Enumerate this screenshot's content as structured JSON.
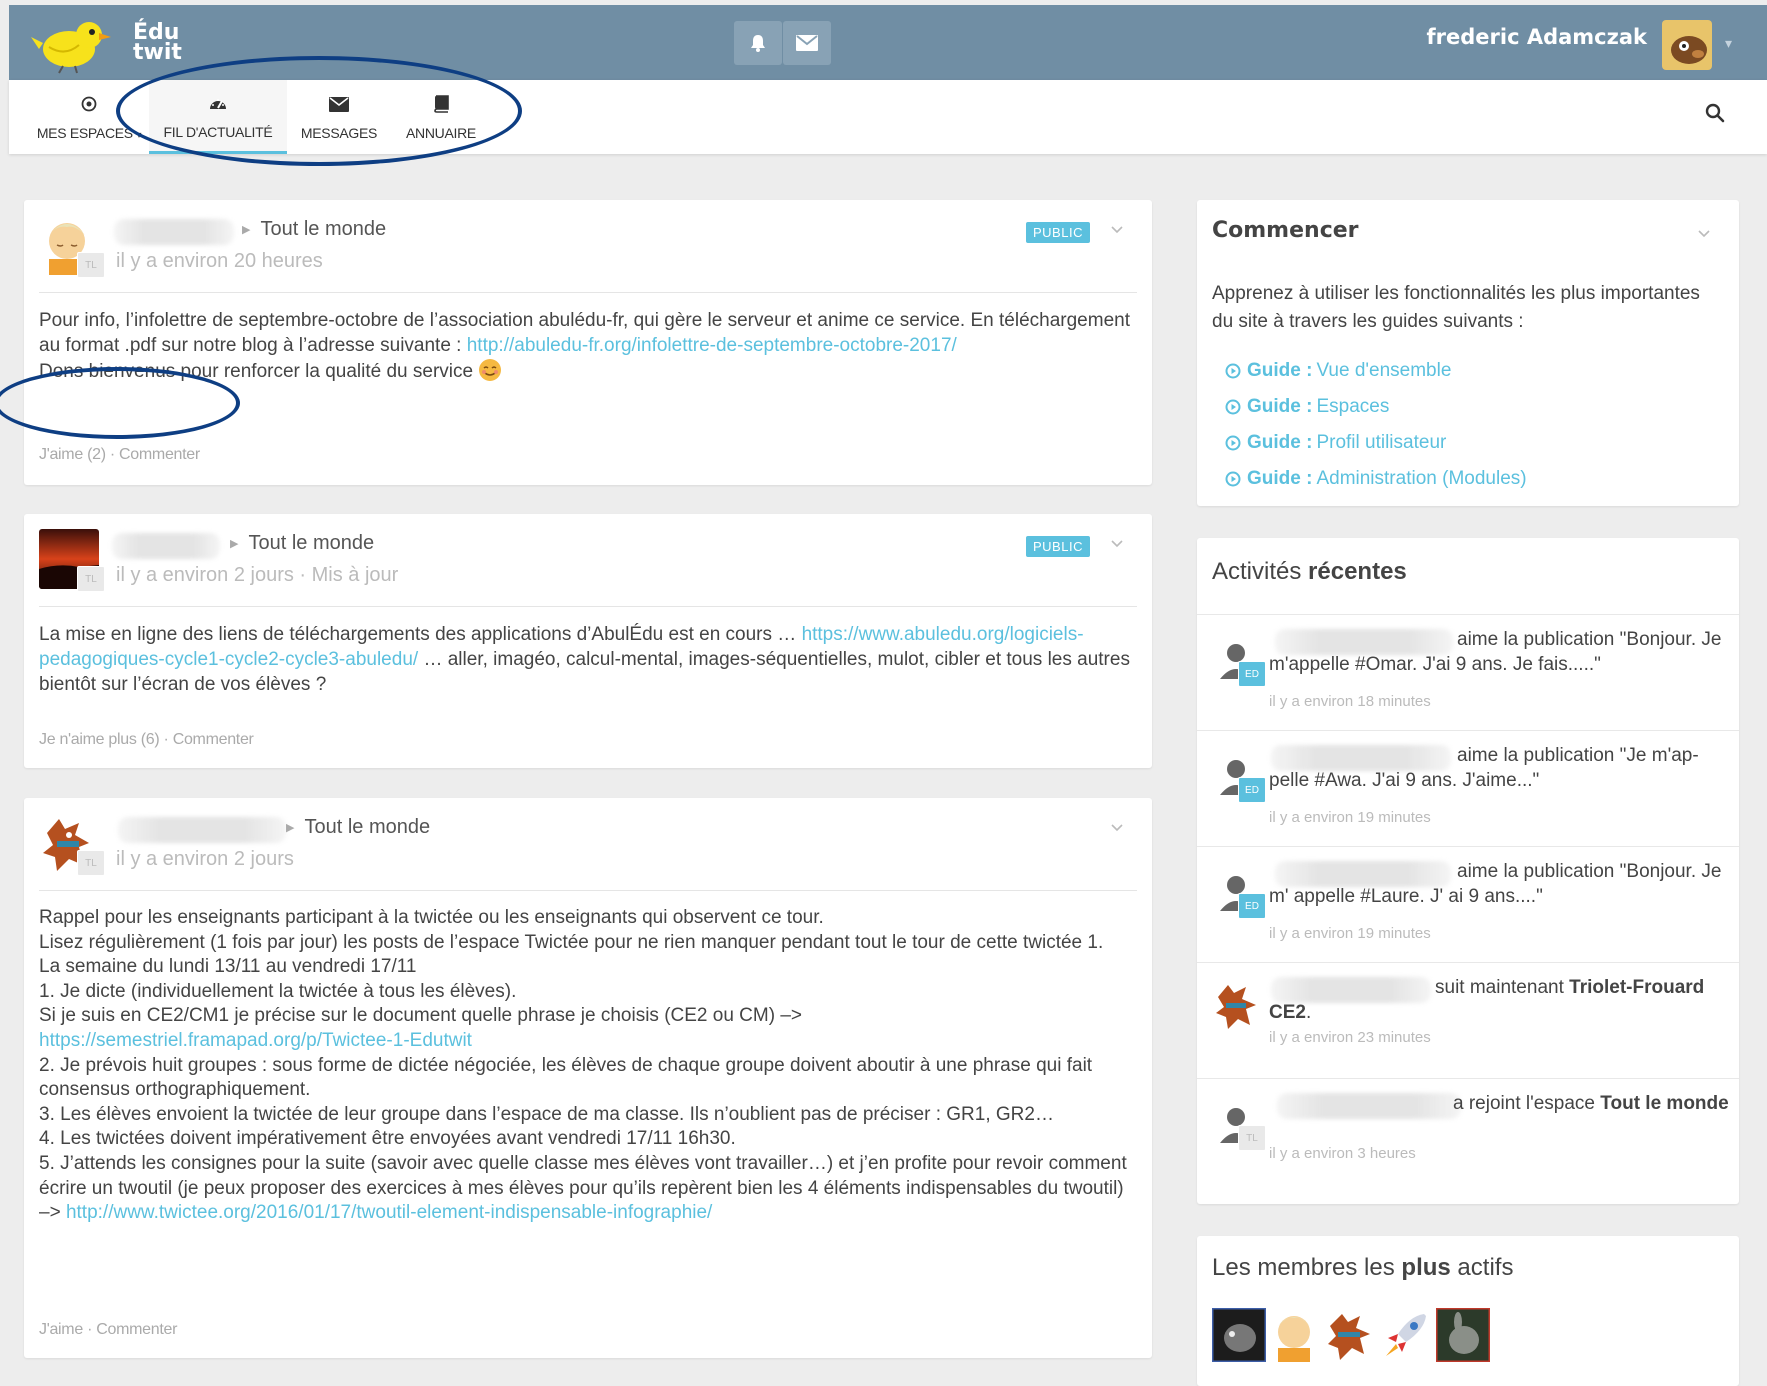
{
  "header": {
    "logo_text_line1": "Édu",
    "logo_text_line2": "twit",
    "notifications_icon": "bell-icon",
    "messages_icon": "envelope-icon",
    "username": "frederic Adamczak"
  },
  "nav": {
    "items": [
      {
        "label": "MES ESPACES",
        "icon": "target-icon"
      },
      {
        "label": "FIL D'ACTUALITÉ",
        "icon": "dashboard-icon"
      },
      {
        "label": "MESSAGES",
        "icon": "envelope-icon"
      },
      {
        "label": "ANNUAIRE",
        "icon": "book-icon"
      }
    ],
    "search_icon": "search-icon"
  },
  "posts": [
    {
      "target": "Tout le monde",
      "time": "il y a environ 20 heures",
      "badge": "PUBLIC",
      "avatar_badge": "TL",
      "body_text_1": "Pour info, l’infolettre de septembre-octobre de l’association abulédu-fr, qui gère le serveur et anime ce service. En téléchargement au format .pdf sur notre blog à l’adresse suivante : ",
      "body_link_1": "http://abuledu-fr.org/infolettre-de-septembre-octobre-2017/",
      "body_text_2": "Dons bienvenus pour renforcer la qualité du service",
      "footer": "J'aime (2) · Commenter"
    },
    {
      "target": "Tout le monde",
      "time": "il y a environ 2 jours · Mis à jour",
      "badge": "PUBLIC",
      "avatar_badge": "TL",
      "body_text_1": "La mise en ligne des liens de téléchargements des applications d’AbulÉdu est en cours … ",
      "body_link_1": "https://www.abuledu.org/logiciels-pedagogiques-cycle1-cycle2-cycle3-abuledu/",
      "body_text_2": " … aller, imagéo, calcul-mental, images-séquentielles, mulot, cibler et tous les autres bientôt sur l’écran de vos élèves ?",
      "footer": "Je n'aime plus (6) · Commenter"
    },
    {
      "target": "Tout le monde",
      "time": "il y a environ 2 jours",
      "avatar_badge": "TL",
      "lines": [
        "Rappel pour les enseignants participant à la twictée ou les enseignants qui observent ce tour.",
        "Lisez régulièrement (1 fois par jour) les posts de l’espace Twictée pour ne rien manquer pendant tout le tour de cette twictée 1.",
        "La semaine du lundi 13/11 au vendredi 17/11",
        "1. Je dicte (individuellement la twictée à tous les élèves)."
      ],
      "line_link_pre": "Si je suis en CE2/CM1 je précise sur le document quelle phrase je choisis (CE2 ou CM) –> ",
      "line_link": "https://semestriel.framapad.org/p/Twictee-1-Edutwit",
      "lines_2": [
        "2. Je prévois huit groupes : sous forme de dictée négociée, les élèves de chaque groupe doivent aboutir à une phrase qui fait consensus orthographiquement.",
        "3. Les élèves envoient la twictée de leur groupe dans l’espace de ma classe. Ils n’oublient pas de préciser : GR1, GR2…",
        "4. Les twictées doivent impérativement être envoyées avant vendredi 17/11 16h30."
      ],
      "last_pre": "5. J’attends les consignes pour la suite (savoir avec quelle classe mes élèves vont travailler…) et j’en profite pour revoir comment écrire un twoutil (je peux proposer des exercices à mes élèves pour qu’ils repèrent bien les 4 éléments indispensables du twoutil) –> ",
      "last_link": "http://www.twictee.org/2016/01/17/twoutil-element-indispensable-infographie/",
      "footer": "J'aime · Commenter"
    }
  ],
  "sidebar": {
    "start": {
      "title": "Commencer",
      "intro": "Apprenez à utiliser les fonctionnalités les plus importantes du site à travers les guides suivants :",
      "guide_word": "Guide :",
      "guides": [
        "Vue d'ensemble",
        "Espaces",
        "Profil utilisateur",
        "Administration (Modules)"
      ]
    },
    "activity": {
      "title_pre": "Activités",
      "title_bold": "récentes",
      "items": [
        {
          "text": "aime la publication \"Bonjour. Je m'appelle #Omar. J'ai 9 ans. Je fais.....\"",
          "time": "il y a environ 18 minutes",
          "badge": "ED"
        },
        {
          "text": "aime la publication \"Je m'ap- pelle #Awa. J'ai 9 ans. J'aime...\"",
          "time": "il y a environ 19 minutes",
          "badge": "ED"
        },
        {
          "text": "aime la publication \"Bonjour. Je m' appelle #Laure. J' ai 9 ans....\"",
          "time": "il y a environ 19 minutes",
          "badge": "ED"
        },
        {
          "text_pre": "suit maintenant ",
          "text_bold": "Triolet-Frouard CE2",
          "text_post": ".",
          "time": "il y a environ 23 minutes"
        },
        {
          "text_pre": "a rejoint l'espace ",
          "text_bold": "Tout le monde",
          "text_post": "",
          "time": "il y a environ 3 heures",
          "badge": "TL"
        }
      ]
    },
    "members": {
      "title_pre": "Les membres les",
      "title_bold": "plus",
      "title_post": "actifs"
    }
  }
}
